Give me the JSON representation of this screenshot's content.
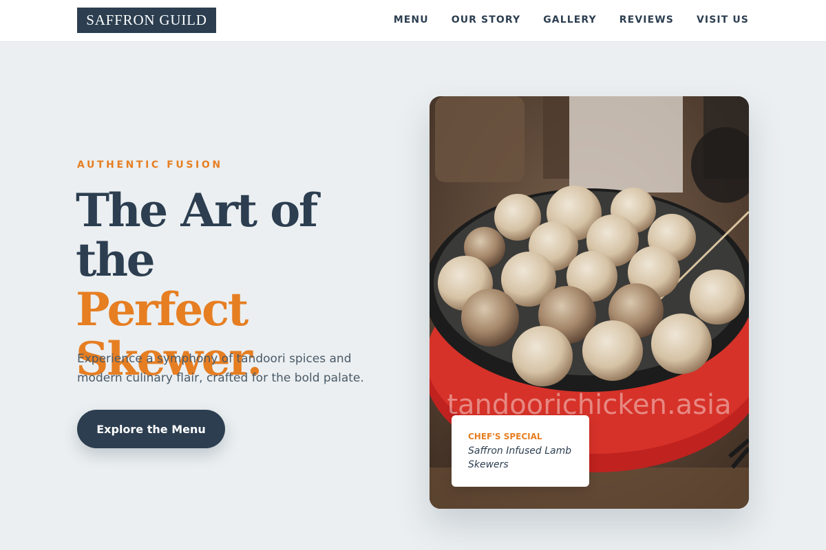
{
  "header": {
    "logo": "SAFFRON GUILD",
    "nav": [
      {
        "label": "MENU"
      },
      {
        "label": "OUR STORY"
      },
      {
        "label": "GALLERY"
      },
      {
        "label": "REVIEWS"
      },
      {
        "label": "VISIT US"
      }
    ]
  },
  "hero": {
    "eyebrow": "AUTHENTIC FUSION",
    "headline_line1": "The Art of the",
    "headline_line2": "Perfect",
    "headline_line3": "Skewer.",
    "lead": "Experience a symphony of tandoori spices and modern culinary flair, crafted for the bold palate.",
    "cta_label": "Explore the Menu"
  },
  "photo": {
    "watermark": "tandoorichicken.asia",
    "special": {
      "label": "CHEF'S SPECIAL",
      "name": "Saffron Infused Lamb Skewers"
    }
  },
  "colors": {
    "primary": "#2c3e50",
    "accent": "#e67e22",
    "background": "#ebeff1"
  }
}
